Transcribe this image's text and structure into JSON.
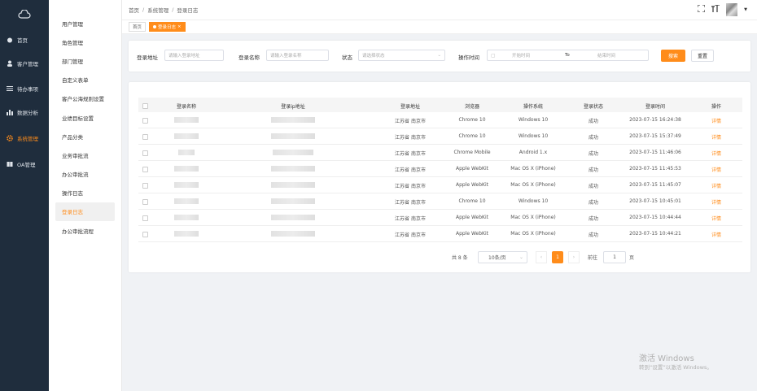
{
  "sidebar": {
    "items": [
      {
        "label": "首页",
        "icon": "dashboard-icon",
        "active": false
      },
      {
        "label": "客户管理",
        "icon": "user-icon",
        "active": false
      },
      {
        "label": "待办事项",
        "icon": "list-icon",
        "active": false
      },
      {
        "label": "数据分析",
        "icon": "chart-icon",
        "active": false
      },
      {
        "label": "系统管理",
        "icon": "gear-icon",
        "active": true
      },
      {
        "label": "OA管理",
        "icon": "book-icon",
        "active": false
      }
    ]
  },
  "submenu": {
    "items": [
      "用户管理",
      "角色管理",
      "部门管理",
      "自定义表单",
      "客户公海规则设置",
      "业绩目标设置",
      "产品分类",
      "业务审批流",
      "办公审批流",
      "操作日志",
      "登录日志",
      "办公审批流程"
    ],
    "active": "登录日志"
  },
  "breadcrumb": {
    "home": "首页",
    "section": "系统管理",
    "page": "登录日志",
    "sep": "/"
  },
  "tags": {
    "home": "首页",
    "current": "登录日志",
    "close": "×"
  },
  "filter": {
    "login_addr_label": "登录地址",
    "login_addr_placeholder": "请输入登录地址",
    "login_name_label": "登录名称",
    "login_name_placeholder": "请输入登录名称",
    "status_label": "状态",
    "status_placeholder": "请选择状态",
    "time_label": "操作时间",
    "start_placeholder": "开始时间",
    "to": "To",
    "end_placeholder": "结束时间",
    "search_btn": "搜索",
    "reset_btn": "重置"
  },
  "table": {
    "headers": [
      "登录名称",
      "登录ip地址",
      "登录地址",
      "浏览器",
      "操作系统",
      "登录状态",
      "登录时间",
      "操作"
    ],
    "rows": [
      {
        "addr": "江苏省 南京市",
        "browser": "Chrome 10",
        "os": "Windows 10",
        "status": "成功",
        "time": "2023-07-15 16:24:38",
        "action": "详情"
      },
      {
        "addr": "江苏省 南京市",
        "browser": "Chrome 10",
        "os": "Windows 10",
        "status": "成功",
        "time": "2023-07-15 15:37:49",
        "action": "详情"
      },
      {
        "addr": "江苏省 南京市",
        "browser": "Chrome Mobile",
        "os": "Android 1.x",
        "status": "成功",
        "time": "2023-07-15 11:46:06",
        "action": "详情"
      },
      {
        "addr": "江苏省 南京市",
        "browser": "Apple WebKit",
        "os": "Mac OS X (iPhone)",
        "status": "成功",
        "time": "2023-07-15 11:45:53",
        "action": "详情"
      },
      {
        "addr": "江苏省 南京市",
        "browser": "Apple WebKit",
        "os": "Mac OS X (iPhone)",
        "status": "成功",
        "time": "2023-07-15 11:45:07",
        "action": "详情"
      },
      {
        "addr": "江苏省 南京市",
        "browser": "Chrome 10",
        "os": "Windows 10",
        "status": "成功",
        "time": "2023-07-15 10:45:01",
        "action": "详情"
      },
      {
        "addr": "江苏省 南京市",
        "browser": "Apple WebKit",
        "os": "Mac OS X (iPhone)",
        "status": "成功",
        "time": "2023-07-15 10:44:44",
        "action": "详情"
      },
      {
        "addr": "江苏省 南京市",
        "browser": "Apple WebKit",
        "os": "Mac OS X (iPhone)",
        "status": "成功",
        "time": "2023-07-15 10:44:21",
        "action": "详情"
      }
    ]
  },
  "pager": {
    "total": "共 8 条",
    "page_size": "10条/页",
    "current": "1",
    "goto_prefix": "前往",
    "goto_value": "1",
    "goto_suffix": "页",
    "prev": "‹",
    "next": "›"
  },
  "watermark": {
    "title": "激活 Windows",
    "sub": "转到“设置”以激活 Windows。"
  },
  "colors": {
    "accent": "#ff8c1a",
    "sidebar": "#1f2d3d"
  }
}
